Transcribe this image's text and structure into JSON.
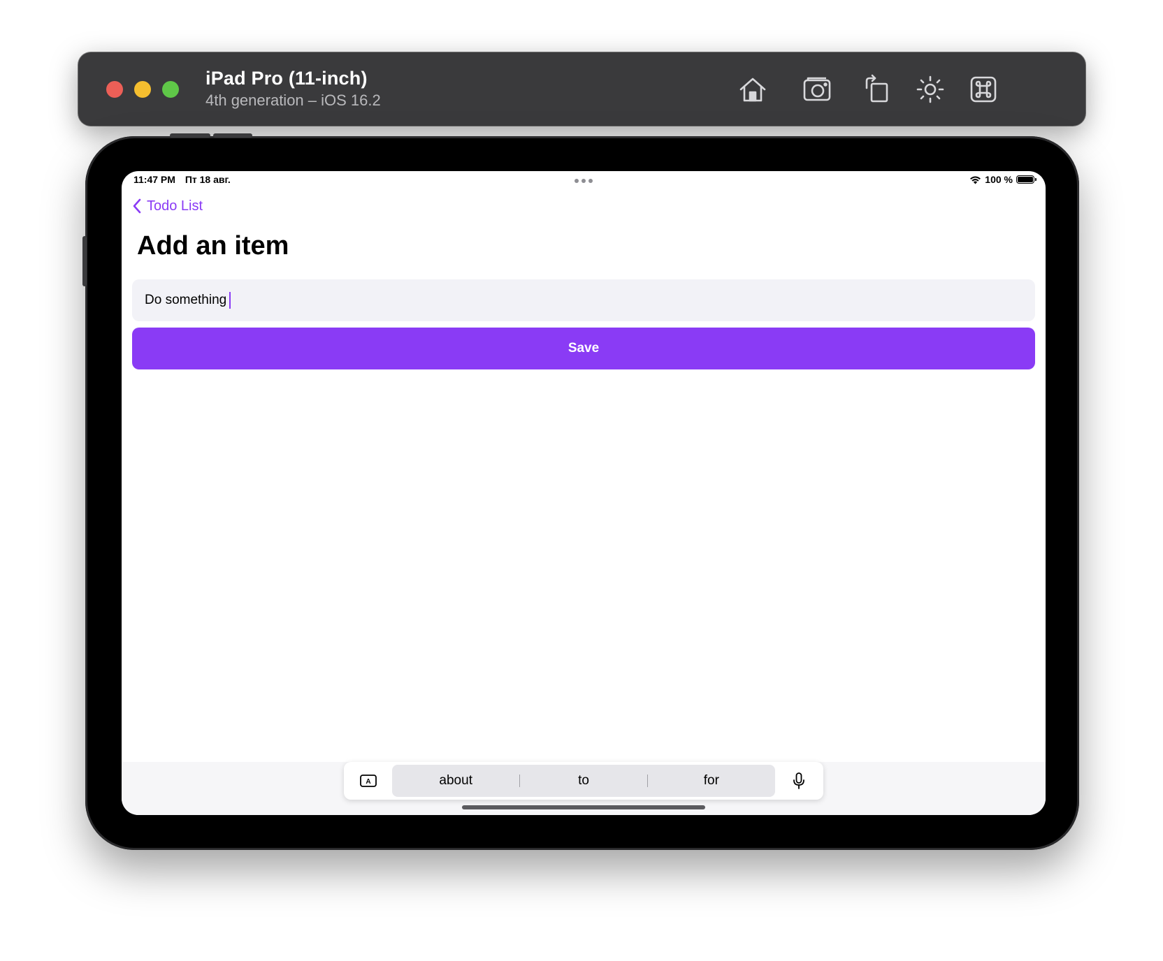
{
  "simulator": {
    "device_name": "iPad Pro (11-inch)",
    "device_detail": "4th generation – iOS 16.2",
    "toolbar_icons": [
      "home-icon",
      "screenshot-icon",
      "rotate-icon",
      "appearance-icon",
      "command-icon"
    ]
  },
  "status_bar": {
    "time": "11:47 PM",
    "date": "Пт 18 авг.",
    "battery_text": "100 %",
    "battery_level": 1.0
  },
  "nav": {
    "back_label": "Todo List"
  },
  "page": {
    "title": "Add an item",
    "input_value": "Do something",
    "save_label": "Save"
  },
  "keyboard_bar": {
    "suggestions": [
      "about",
      "to",
      "for"
    ]
  },
  "colors": {
    "accent": "#8a3bf5",
    "field_bg": "#f2f2f7",
    "toolbar_bg": "#3a3a3c"
  }
}
